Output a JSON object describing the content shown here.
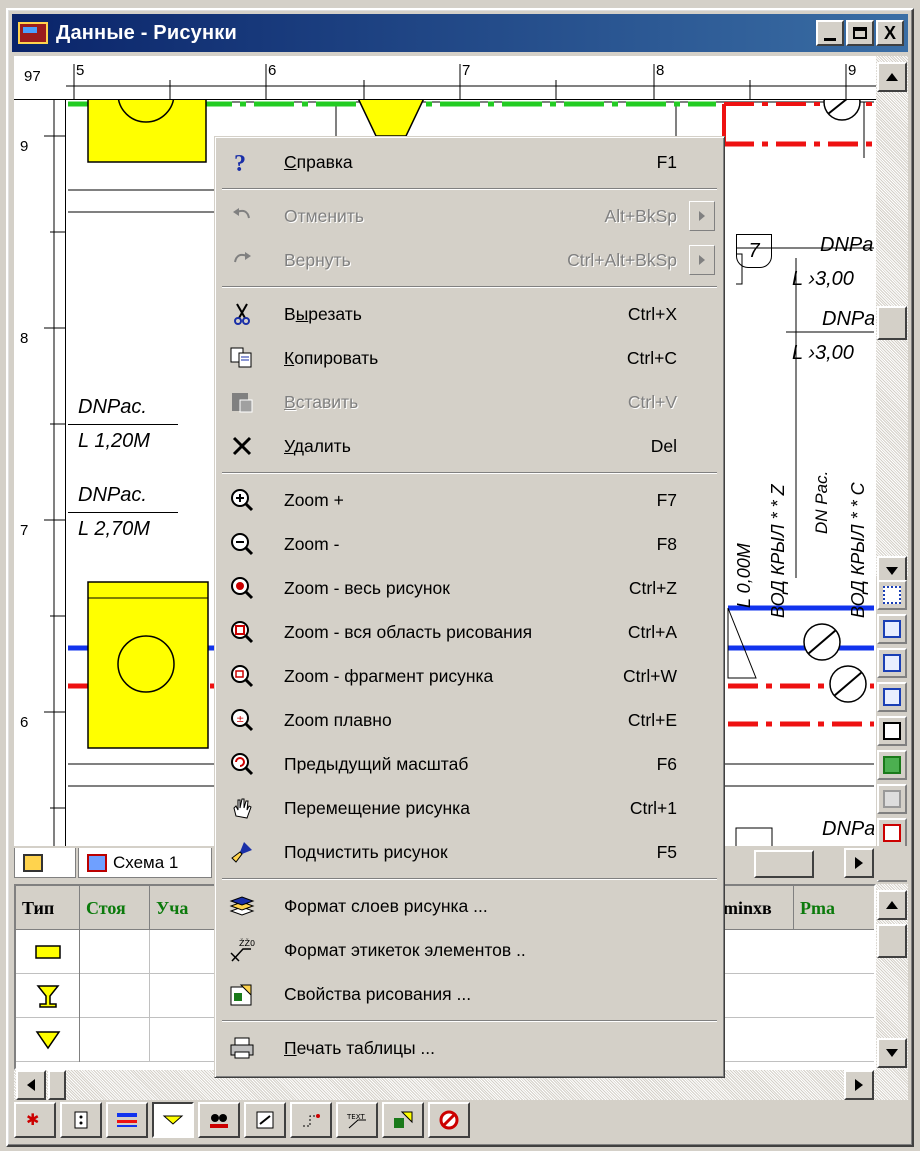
{
  "window": {
    "title": "Данные - Рисунки",
    "buttons": {
      "minimize": "_",
      "maximize": "□",
      "close": "X"
    }
  },
  "ruler": {
    "top": [
      "97",
      "5",
      "6",
      "7",
      "8",
      "9"
    ],
    "left": [
      "9",
      "8",
      "7",
      "6"
    ]
  },
  "drawing": {
    "labels": {
      "dnpac_1": "DNPac.",
      "len_1": "L 1,20M",
      "dnpac_2": "DNPac.",
      "len_2": "L 2,70M",
      "node_7": "7",
      "dnpa_1": "DNPa",
      "len_r1": "L ›3,00",
      "dnpa_2": "DNPa",
      "len_r2": "L ›3,00",
      "vert_1": "ВОД КРЫЛ * * Z",
      "vert_2": "DN Pac.",
      "vert_3": "ВОД КРЫЛ * * C",
      "vert_4": "L 0,00M",
      "node_bottom": "6",
      "dnpa_3": "DNPa"
    }
  },
  "sheet_tabs": [
    {
      "label": ""
    },
    {
      "label": "Схема 1"
    }
  ],
  "grid": {
    "headers": [
      {
        "text": "Тип",
        "color": "black"
      },
      {
        "text": "Стоя",
        "color": "green"
      },
      {
        "text": "Уча",
        "color": "green"
      },
      {
        "text": "minxв",
        "color": "black"
      },
      {
        "text": "Pma",
        "color": "green"
      }
    ],
    "rows": [
      {
        "icon": "rect-yellow-icon"
      },
      {
        "icon": "goblet-yellow-icon"
      },
      {
        "icon": "triangle-yellow-icon"
      }
    ]
  },
  "context_menu": {
    "items": [
      {
        "icon": "help-icon",
        "label_pre": "",
        "label_u": "С",
        "label_post": "правка",
        "shortcut": "F1",
        "disabled": false
      },
      {
        "sep": true
      },
      {
        "icon": "undo-icon",
        "label_pre": "Отменить",
        "label_u": "",
        "label_post": "",
        "shortcut": "Alt+BkSp",
        "disabled": true,
        "submenu": true
      },
      {
        "icon": "redo-icon",
        "label_pre": "Вернуть",
        "label_u": "",
        "label_post": "",
        "shortcut": "Ctrl+Alt+BkSp",
        "disabled": true,
        "submenu": true
      },
      {
        "sep": true
      },
      {
        "icon": "scissors-icon",
        "label_pre": "В",
        "label_u": "ы",
        "label_post": "резать",
        "shortcut": "Ctrl+X",
        "disabled": false
      },
      {
        "icon": "copy-icon",
        "label_pre": "",
        "label_u": "К",
        "label_post": "опировать",
        "shortcut": "Ctrl+C",
        "disabled": false
      },
      {
        "icon": "paste-icon",
        "label_pre": "",
        "label_u": "В",
        "label_post": "ставить",
        "shortcut": "Ctrl+V",
        "disabled": true
      },
      {
        "icon": "delete-icon",
        "label_pre": "",
        "label_u": "У",
        "label_post": "далить",
        "shortcut": "Del",
        "disabled": false
      },
      {
        "sep": true
      },
      {
        "icon": "zoom-in-icon",
        "label_pre": "Zoom +",
        "label_u": "",
        "label_post": "",
        "shortcut": "F7",
        "disabled": false
      },
      {
        "icon": "zoom-out-icon",
        "label_pre": "Zoom -",
        "label_u": "",
        "label_post": "",
        "shortcut": "F8",
        "disabled": false
      },
      {
        "icon": "zoom-all-icon",
        "label_pre": "Zoom - весь рисунок",
        "label_u": "",
        "label_post": "",
        "shortcut": "Ctrl+Z",
        "disabled": false
      },
      {
        "icon": "zoom-area-icon",
        "label_pre": "Zoom - вся область рисования",
        "label_u": "",
        "label_post": "",
        "shortcut": "Ctrl+A",
        "disabled": false
      },
      {
        "icon": "zoom-fragment-icon",
        "label_pre": "Zoom - фрагмент рисунка",
        "label_u": "",
        "label_post": "",
        "shortcut": "Ctrl+W",
        "disabled": false
      },
      {
        "icon": "zoom-smooth-icon",
        "label_pre": "Zoom плавно",
        "label_u": "",
        "label_post": "",
        "shortcut": "Ctrl+E",
        "disabled": false
      },
      {
        "icon": "zoom-previous-icon",
        "label_pre": "Предыдущий масштаб",
        "label_u": "",
        "label_post": "",
        "shortcut": "F6",
        "disabled": false
      },
      {
        "icon": "hand-pan-icon",
        "label_pre": "Перемещение рисунка",
        "label_u": "",
        "label_post": "",
        "shortcut": "Ctrl+1",
        "disabled": false
      },
      {
        "icon": "brush-clean-icon",
        "label_pre": "Подчистить рисунок",
        "label_u": "",
        "label_post": "",
        "shortcut": "F5",
        "disabled": false
      },
      {
        "sep": true
      },
      {
        "icon": "layers-format-icon",
        "label_pre": "Формат слоев рисунка ...",
        "label_u": "",
        "label_post": "",
        "shortcut": "",
        "disabled": false
      },
      {
        "icon": "labels-format-icon",
        "label_pre": "Формат этикеток элементов ..",
        "label_u": "",
        "label_post": "",
        "shortcut": "",
        "disabled": false
      },
      {
        "icon": "draw-properties-icon",
        "label_pre": "Свойства рисования ...",
        "label_u": "",
        "label_post": "",
        "shortcut": "",
        "disabled": false
      },
      {
        "sep": true
      },
      {
        "icon": "printer-icon",
        "label_pre": "",
        "label_u": "П",
        "label_post": "ечать таблицы ...",
        "shortcut": "",
        "disabled": false
      }
    ]
  },
  "colors": {
    "title_start": "#0a246a",
    "title_end": "#3a6ea5",
    "pipe_green": "#22cc22",
    "pipe_red": "#ee1111",
    "pipe_blue": "#1133ee",
    "element_yellow": "#ffff00"
  }
}
